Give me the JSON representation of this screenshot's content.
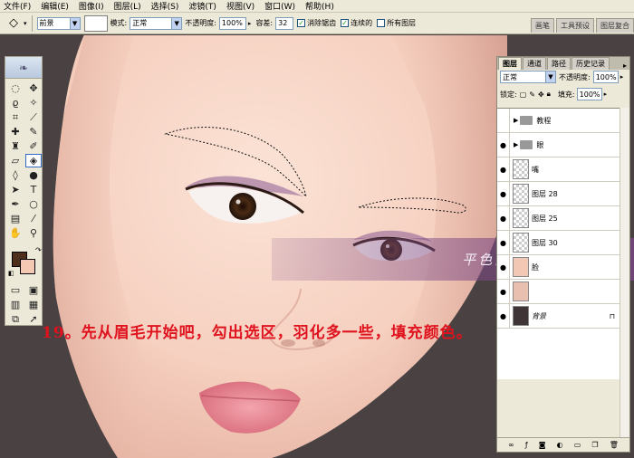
{
  "menu": [
    "文件(F)",
    "编辑(E)",
    "图像(I)",
    "图层(L)",
    "选择(S)",
    "滤镜(T)",
    "视图(V)",
    "窗口(W)",
    "帮助(H)"
  ],
  "options": {
    "fill_source": "前景",
    "mode_label": "模式:",
    "mode_value": "正常",
    "opacity_label": "不透明度:",
    "opacity_value": "100%",
    "tolerance_label": "容差:",
    "tolerance_value": "32",
    "antialias_label": "消除锯齿",
    "contiguous_label": "连续的",
    "all_layers_label": "所有图层"
  },
  "palette_well": [
    "画笔",
    "工具预设",
    "图层复合"
  ],
  "layers_panel": {
    "tabs": [
      "图层",
      "通道",
      "路径",
      "历史记录"
    ],
    "blend_mode": "正常",
    "opacity_label": "不透明度:",
    "opacity_value": "100%",
    "lock_label": "锁定:",
    "fill_label": "填充:",
    "fill_value": "100%",
    "layers": [
      {
        "name": "教程",
        "kind": "group"
      },
      {
        "name": "眼",
        "kind": "group"
      },
      {
        "name": "嘴",
        "kind": "layer"
      },
      {
        "name": "图层 28",
        "kind": "layer"
      },
      {
        "name": "图层 25",
        "kind": "layer"
      },
      {
        "name": "图层 30",
        "kind": "layer"
      },
      {
        "name": "脸",
        "kind": "layer"
      },
      {
        "name": "",
        "kind": "layer"
      },
      {
        "name": "背景",
        "kind": "background"
      }
    ]
  },
  "banner_text": "平色韵笔绘 原创教程",
  "caption_text": "19。先从眉毛开始吧，勾出选区，羽化多一些，填充颜色。",
  "colors": {
    "foreground": "#4e2f1b",
    "background": "#f4c8b2",
    "caption": "#e0121e"
  },
  "icons": [
    "paint-bucket-icon",
    "eye-icon",
    "folder-icon",
    "lock-icon",
    "new-layer-icon",
    "trash-icon"
  ]
}
